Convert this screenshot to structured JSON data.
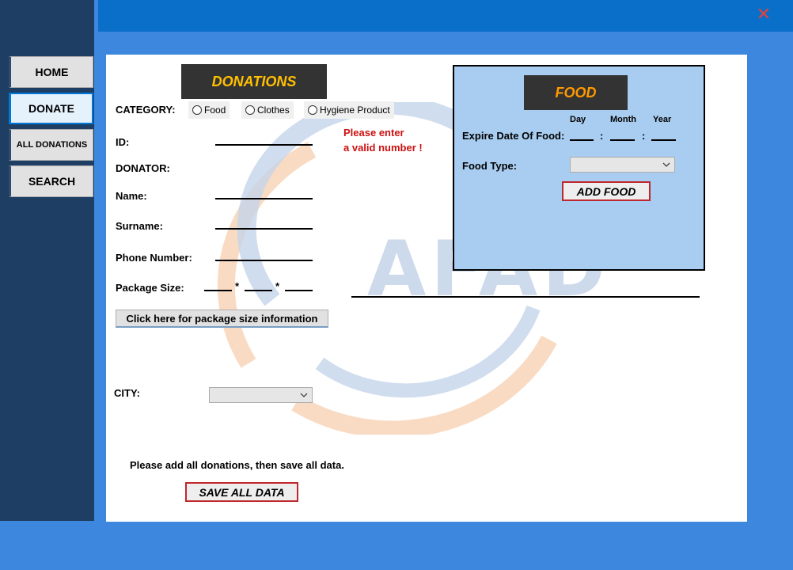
{
  "window": {
    "close_glyph": "✕"
  },
  "nav": {
    "items": [
      {
        "label": "HOME"
      },
      {
        "label": "DONATE"
      },
      {
        "label": "ALL DONATIONS"
      },
      {
        "label": "SEARCH"
      }
    ],
    "active": "DONATE"
  },
  "watermark": {
    "text": "AFAD"
  },
  "donations": {
    "title": "DONATIONS",
    "category_label": "CATEGORY:",
    "categories": [
      "Food",
      "Clothes",
      "Hygiene Product"
    ],
    "id_label": "ID:",
    "id_value": "",
    "donator_label": "DONATOR:",
    "name_label": "Name:",
    "name_value": "",
    "surname_label": "Surname:",
    "surname_value": "",
    "phone_label": "Phone Number:",
    "phone_value": "",
    "package_label": "Package Size:",
    "package_separator": "*",
    "package_info_button": "Click here for package size information",
    "error_line1": "Please enter",
    "error_line2": "a valid number !",
    "city_label": "CITY:",
    "city_value": "",
    "save_note": "Please add all donations, then save all data.",
    "save_button": "SAVE ALL DATA"
  },
  "food": {
    "title": "FOOD",
    "day_label": "Day",
    "month_label": "Month",
    "year_label": "Year",
    "expire_label": "Expire Date Of Food:",
    "date_separator": ":",
    "type_label": "Food Type:",
    "type_value": "",
    "add_button": "ADD FOOD"
  },
  "colors": {
    "titlebar": "#0a6fc9",
    "background": "#3d87de",
    "sidebar": "#1e3e64",
    "heading_bg": "#333333",
    "heading_text": "#ffc000",
    "food_panel": "#a8cdf0",
    "error": "#cc1010",
    "button_border": "#c0272d"
  }
}
